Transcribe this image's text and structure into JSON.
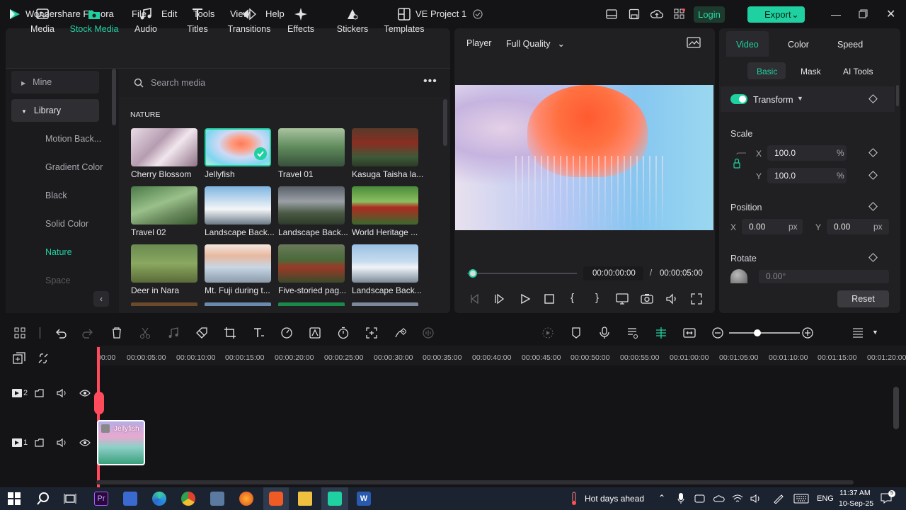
{
  "app": {
    "title": "Wondershare Filmora",
    "project": "VE Project 1"
  },
  "menu": [
    "File",
    "Edit",
    "Tools",
    "View",
    "Help"
  ],
  "header": {
    "login": "Login",
    "export": "Export"
  },
  "tools": [
    "Media",
    "Stock Media",
    "Audio",
    "Titles",
    "Transitions",
    "Effects",
    "Stickers",
    "Templates"
  ],
  "sidebar": {
    "mine": "Mine",
    "library": "Library",
    "items": [
      "Motion Back...",
      "Gradient Color",
      "Black",
      "Solid Color",
      "Nature",
      "Space"
    ]
  },
  "search": {
    "placeholder": "Search media"
  },
  "section": "NATURE",
  "media": [
    "Cherry Blossom",
    "Jellyfish",
    "Travel 01",
    "Kasuga Taisha la...",
    "Travel 02",
    "Landscape Back...",
    "Landscape Back...",
    "World Heritage ...",
    "Deer in Nara",
    "Mt. Fuji during t...",
    "Five-storied pag...",
    "Landscape Back..."
  ],
  "player": {
    "label": "Player",
    "quality": "Full Quality",
    "current": "00:00:00:00",
    "sep": "/",
    "total": "00:00:05:00"
  },
  "props": {
    "tabs": [
      "Video",
      "Color",
      "Speed"
    ],
    "subtabs": [
      "Basic",
      "Mask",
      "AI Tools"
    ],
    "transform": "Transform",
    "scale": "Scale",
    "scale_x": "100.0",
    "scale_y": "100.0",
    "x": "X",
    "y": "Y",
    "percent": "%",
    "position": "Position",
    "pos_x": "0.00",
    "pos_y": "0.00",
    "px": "px",
    "rotate": "Rotate",
    "rotate_val": "0.00°",
    "reset": "Reset"
  },
  "ruler": [
    "00:00",
    "00:00:05:00",
    "00:00:10:00",
    "00:00:15:00",
    "00:00:20:00",
    "00:00:25:00",
    "00:00:30:00",
    "00:00:35:00",
    "00:00:40:00",
    "00:00:45:00",
    "00:00:50:00",
    "00:00:55:00",
    "00:01:00:00",
    "00:01:05:00",
    "00:01:10:00",
    "00:01:15:00",
    "00:01:20:00"
  ],
  "tracks": {
    "track2": "2",
    "track1": "1",
    "clip": "Jellyfish"
  },
  "taskbar": {
    "weather": "Hot days ahead",
    "lang": "ENG",
    "time": "11:37 AM",
    "date": "10-Sep-25"
  },
  "colors": {
    "accent": "#1fd1a0",
    "playhead": "#ff4b5c",
    "panel": "#202023"
  }
}
